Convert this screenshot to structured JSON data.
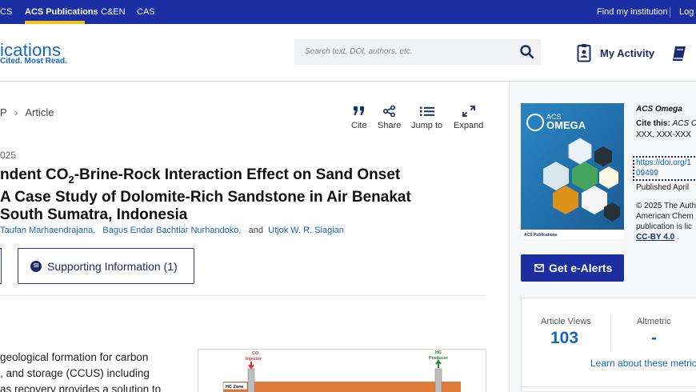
{
  "topnav": {
    "items": [
      "CS",
      "ACS Publications",
      "C&EN",
      "CAS"
    ],
    "right": [
      "Find my institution",
      "Log I"
    ],
    "accent_bar": "#f3c21b"
  },
  "header": {
    "logo_main": "ications",
    "logo_tag": "Cited. Most Read.",
    "search_placeholder": "Search text, DOI, authors, etc.",
    "my_activity": "My Activity"
  },
  "article": {
    "breadcrumb": [
      "P",
      "Article"
    ],
    "tools": [
      "Cite",
      "Share",
      "Jump to",
      "Expand"
    ],
    "pubdate": "025",
    "title_lines": {
      "l1_pre": "ndent CO",
      "l1_sub": "2",
      "l1_post": "-Brine-Rock Interaction Effect on Sand Onset",
      "l2": "A Case Study of Dolomite-Rich Sandstone in Air Benakat",
      "l3": "South Sumatra, Indonesia"
    },
    "authors": {
      "a1": "Taufan Marhaendrajana,",
      "a2": "Bagus Endar Bachtiar Nurhandoko,",
      "and": "and",
      "a3": "Utjok W. R. Siagian"
    },
    "si_badge": "SI",
    "si_label": "Supporting Information (1)",
    "abstract_lines": [
      "geological formation for carbon",
      ", and storage (CCUS) including",
      "as recovery provides a solution to"
    ],
    "toc": {
      "co2_label": [
        "CO",
        "Injector"
      ],
      "hc_label": [
        "HC",
        "Producer"
      ],
      "zone": "HC Zone"
    }
  },
  "sidebar": {
    "cover_brand": [
      "ACS",
      "OMEGA"
    ],
    "cover_footer": "ACS Publications",
    "journal": "ACS Omega",
    "cite_label": "Cite this:",
    "cite_journal": "ACS O",
    "cite_pages": "XXX, XXX-XXX",
    "doi_lines": [
      "https://doi.org/1",
      "09499"
    ],
    "published": "Published April",
    "license_lines": [
      "© 2025 The Auth",
      "American Chem",
      "publication is lic"
    ],
    "license_cc": "CC-BY 4.0",
    "license_period": ".",
    "alerts_label": "Get e-Alerts",
    "metrics": {
      "views_label": "Article Views",
      "views_value": "103",
      "altmetric_label": "Altmetric",
      "altmetric_value": "-",
      "learn": "Learn about these metric"
    }
  }
}
